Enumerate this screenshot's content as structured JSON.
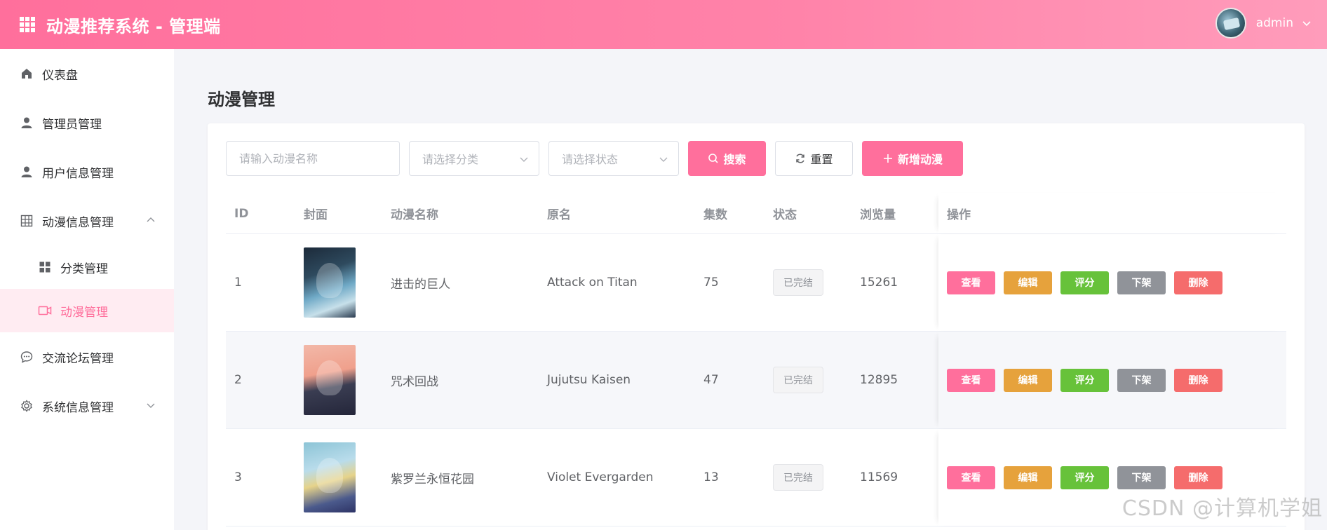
{
  "header": {
    "title": "动漫推荐系统 - 管理端",
    "username": "admin"
  },
  "sidebar": {
    "items": [
      {
        "label": "仪表盘",
        "icon": "home-icon"
      },
      {
        "label": "管理员管理",
        "icon": "user-icon"
      },
      {
        "label": "用户信息管理",
        "icon": "user-icon"
      },
      {
        "label": "动漫信息管理",
        "icon": "grid-icon",
        "expanded": true,
        "children": [
          {
            "label": "分类管理",
            "icon": "category-icon",
            "active": false
          },
          {
            "label": "动漫管理",
            "icon": "video-icon",
            "active": true
          }
        ]
      },
      {
        "label": "交流论坛管理",
        "icon": "chat-icon"
      },
      {
        "label": "系统信息管理",
        "icon": "gear-icon",
        "expanded": false
      }
    ]
  },
  "main": {
    "page_title": "动漫管理",
    "toolbar": {
      "name_placeholder": "请输入动漫名称",
      "category_placeholder": "请选择分类",
      "status_placeholder": "请选择状态",
      "search_label": "搜索",
      "reset_label": "重置",
      "add_label": "新增动漫"
    },
    "table": {
      "headers": {
        "id": "ID",
        "cover": "封面",
        "name": "动漫名称",
        "original": "原名",
        "episodes": "集数",
        "status": "状态",
        "views": "浏览量",
        "ops": "操作"
      },
      "rows": [
        {
          "id": "1",
          "name": "进击的巨人",
          "original": "Attack on Titan",
          "episodes": "75",
          "status": "已完结",
          "views": "15261"
        },
        {
          "id": "2",
          "name": "咒术回战",
          "original": "Jujutsu Kaisen",
          "episodes": "47",
          "status": "已完结",
          "views": "12895"
        },
        {
          "id": "3",
          "name": "紫罗兰永恒花园",
          "original": "Violet Evergarden",
          "episodes": "13",
          "status": "已完结",
          "views": "11569"
        }
      ],
      "actions": {
        "view": "查看",
        "edit": "编辑",
        "rate": "评分",
        "offline": "下架",
        "delete": "删除"
      }
    }
  },
  "watermark": "CSDN @计算机学姐",
  "colors": {
    "primary": "#ff6f9c",
    "warning": "#e6a23c",
    "success": "#67c23a",
    "info": "#909399",
    "danger": "#f56c6c"
  }
}
